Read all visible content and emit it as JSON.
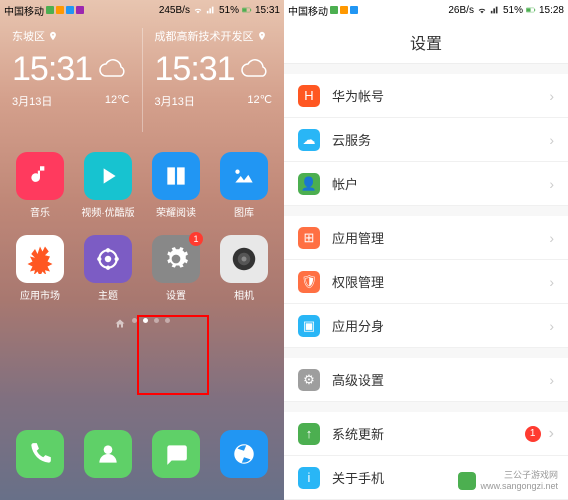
{
  "left": {
    "status": {
      "carrier": "中国移动",
      "speed": "245B/s",
      "battery": "51%",
      "time": "15:31"
    },
    "weather": {
      "col1": {
        "location": "东坡区",
        "time": "15:31",
        "date": "3月13日",
        "temp": "12℃"
      },
      "col2": {
        "location": "成都高新技术开发区",
        "time": "15:31",
        "date": "3月13日",
        "temp": "12℃"
      }
    },
    "apps": {
      "row1": [
        {
          "label": "音乐",
          "bg": "#ff3a5e"
        },
        {
          "label": "视频·优酷版",
          "bg": "#17c3d0"
        },
        {
          "label": "荣耀阅读",
          "bg": "#2196f3"
        },
        {
          "label": "图库",
          "bg": "#2196f3"
        }
      ],
      "row2": [
        {
          "label": "应用市场",
          "bg": "#ffffff"
        },
        {
          "label": "主题",
          "bg": "#7c5cc4"
        },
        {
          "label": "设置",
          "bg": "#888888",
          "badge": "1"
        },
        {
          "label": "相机",
          "bg": "#e8e8e8"
        }
      ]
    },
    "dock": [
      {
        "name": "phone",
        "bg": "#5fd068"
      },
      {
        "name": "contacts",
        "bg": "#5fd068"
      },
      {
        "name": "messages",
        "bg": "#5fd068"
      },
      {
        "name": "browser",
        "bg": "#2196f3"
      }
    ]
  },
  "right": {
    "status": {
      "carrier": "中国移动",
      "speed": "26B/s",
      "battery": "51%",
      "time": "15:28"
    },
    "title": "设置",
    "items": [
      {
        "label": "华为帐号",
        "iconBg": "#ff5722",
        "iconGlyph": "H"
      },
      {
        "label": "云服务",
        "iconBg": "#29b6f6",
        "iconGlyph": "☁"
      },
      {
        "label": "帐户",
        "iconBg": "#4caf50",
        "iconGlyph": "👤"
      }
    ],
    "items2": [
      {
        "label": "应用管理",
        "iconBg": "#ff7043",
        "iconGlyph": "⊞"
      },
      {
        "label": "权限管理",
        "iconBg": "#ff7043",
        "iconGlyph": "🛡"
      },
      {
        "label": "应用分身",
        "iconBg": "#29b6f6",
        "iconGlyph": "▣"
      }
    ],
    "items3": [
      {
        "label": "高级设置",
        "iconBg": "#9e9e9e",
        "iconGlyph": "⚙"
      }
    ],
    "items4": [
      {
        "label": "系统更新",
        "iconBg": "#4caf50",
        "iconGlyph": "↑",
        "badge": "1"
      },
      {
        "label": "关于手机",
        "iconBg": "#29b6f6",
        "iconGlyph": "i"
      }
    ]
  },
  "watermark": {
    "line1": "三公子游戏网",
    "line2": "www.sangongzi.net"
  }
}
